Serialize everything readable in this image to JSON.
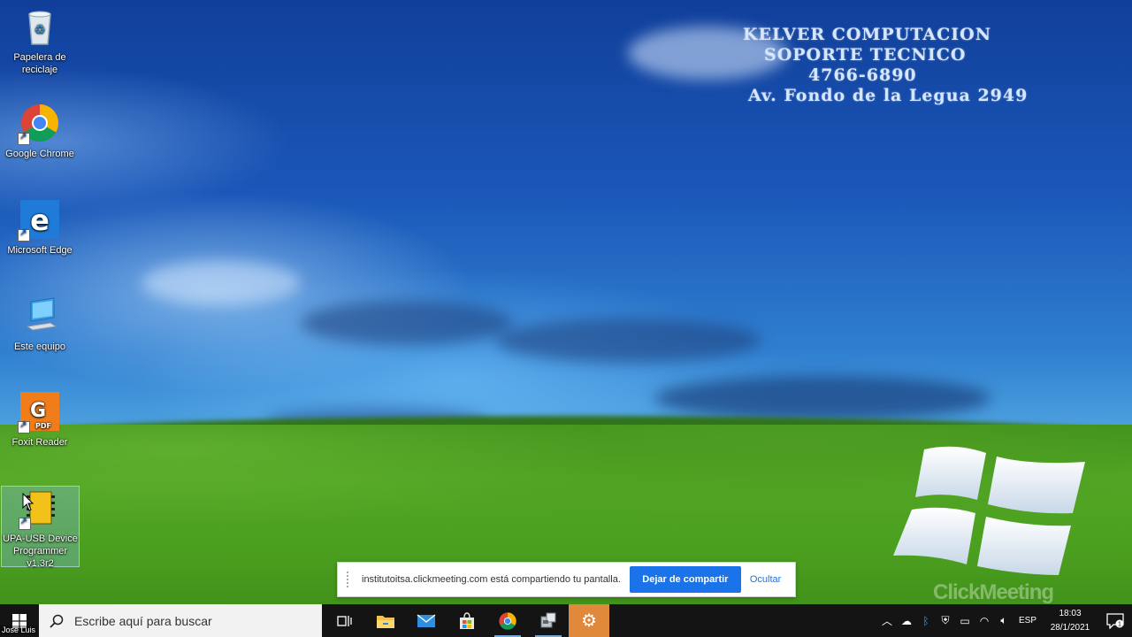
{
  "wallpaper": {
    "lines": [
      "KELVER COMPUTACION",
      "SOPORTE TECNICO",
      "4766-6890",
      "Av. Fondo de la Legua 2949"
    ]
  },
  "desktop_icons": [
    {
      "label": "Papelera de reciclaje",
      "icon": "recycle-bin-icon"
    },
    {
      "label": "Google Chrome",
      "icon": "chrome-icon"
    },
    {
      "label": "Microsoft Edge",
      "icon": "edge-icon"
    },
    {
      "label": "Este equipo",
      "icon": "computer-icon"
    },
    {
      "label": "Foxit Reader",
      "icon": "foxit-reader-icon"
    },
    {
      "label": "UPA-USB Device Programmer v1.3r2",
      "icon": "upa-programmer-icon"
    }
  ],
  "share_banner": {
    "message": "institutoitsa.clickmeeting.com está compartiendo tu pantalla.",
    "stop_label": "Dejar de compartir",
    "hide_label": "Ocultar"
  },
  "watermark": "ClickMeeting",
  "webcam_label": "Jose Luis",
  "taskbar": {
    "search_placeholder": "Escribe aquí para buscar",
    "pinned": [
      "task-view-icon",
      "file-explorer-icon",
      "mail-icon",
      "store-icon",
      "chrome-icon",
      "program-icon",
      "settings-icon"
    ],
    "tray_language": "ESP",
    "time": "18:03",
    "date": "28/1/2021",
    "notification_count": "1"
  },
  "colors": {
    "taskbar": "#141414",
    "active_app": "#e0893b",
    "share_button": "#1a73e8"
  }
}
